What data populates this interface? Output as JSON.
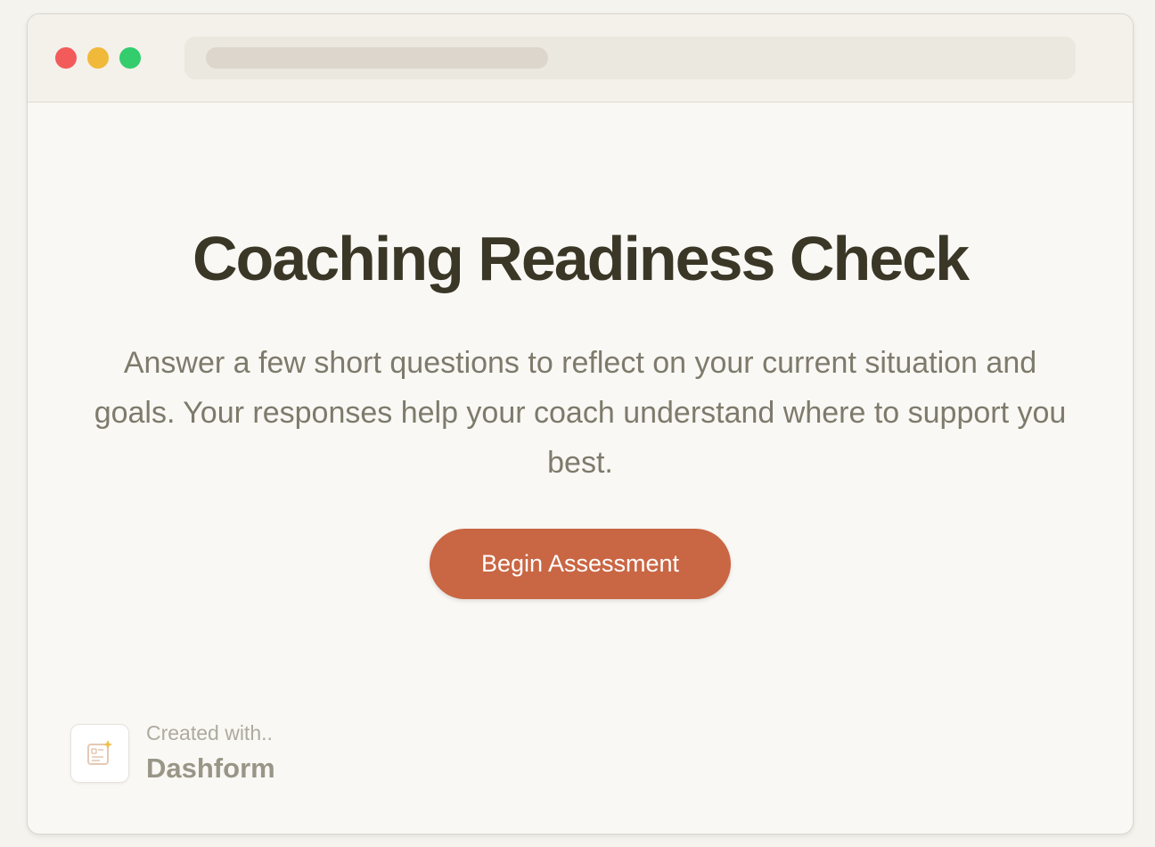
{
  "window": {
    "traffic_lights": {
      "close_color": "#f35b5b",
      "minimize_color": "#f1b93a",
      "maximize_color": "#33cd6e"
    }
  },
  "main": {
    "title": "Coaching Readiness Check",
    "description": "Answer a few short questions to reflect on your current situation and goals. Your responses help your coach understand where to support you best.",
    "begin_button_label": "Begin Assessment"
  },
  "badge": {
    "caption": "Created with..",
    "brand": "Dashform",
    "icon": "form-sparkle-icon"
  },
  "colors": {
    "accent": "#c96644",
    "title": "#3a3727",
    "body_text": "#7e7a6c",
    "background": "#faf8f4"
  }
}
